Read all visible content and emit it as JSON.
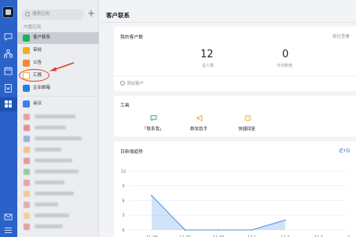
{
  "sidebar": {
    "search_placeholder": "搜索应用",
    "add_symbol": "+",
    "section_title": "内置应用",
    "items": [
      {
        "label": "客户联系",
        "color": "#19b45b",
        "active": true
      },
      {
        "label": "审批",
        "color": "#f1b21f",
        "active": false
      },
      {
        "label": "公告",
        "color": "#f18a2a",
        "active": false
      },
      {
        "label": "汇报",
        "color": "#f5b323",
        "active": false
      },
      {
        "label": "企业邮箱",
        "color": "#2a7be0",
        "active": false
      },
      {
        "label": "会议",
        "color": "#3d7ee8",
        "active": false
      }
    ]
  },
  "main": {
    "title": "客户联系",
    "my_customers": {
      "title": "我的客户数",
      "link": "前往查看",
      "total_value": "12",
      "total_label": "总人数",
      "today_value": "0",
      "today_label": "今日新增",
      "add_label": "添加客户"
    },
    "tools": {
      "title": "工具",
      "items": [
        "「联系我」",
        "群发助手",
        "快捷回复"
      ]
    },
    "trend": {
      "title": "日新增趋势",
      "range": "近7日"
    }
  },
  "chart_data": {
    "type": "area",
    "title": "日新增趋势",
    "categories": [
      "11.28",
      "11.29",
      "11.30",
      "12.1",
      "12.2",
      "12.3",
      "12.4"
    ],
    "values": [
      7,
      0,
      0,
      0,
      2,
      null,
      null
    ],
    "y_ticks": [
      0,
      3,
      6,
      9,
      12
    ],
    "ylim": [
      0,
      12
    ],
    "color": "#4a8fe6",
    "grid": true
  }
}
